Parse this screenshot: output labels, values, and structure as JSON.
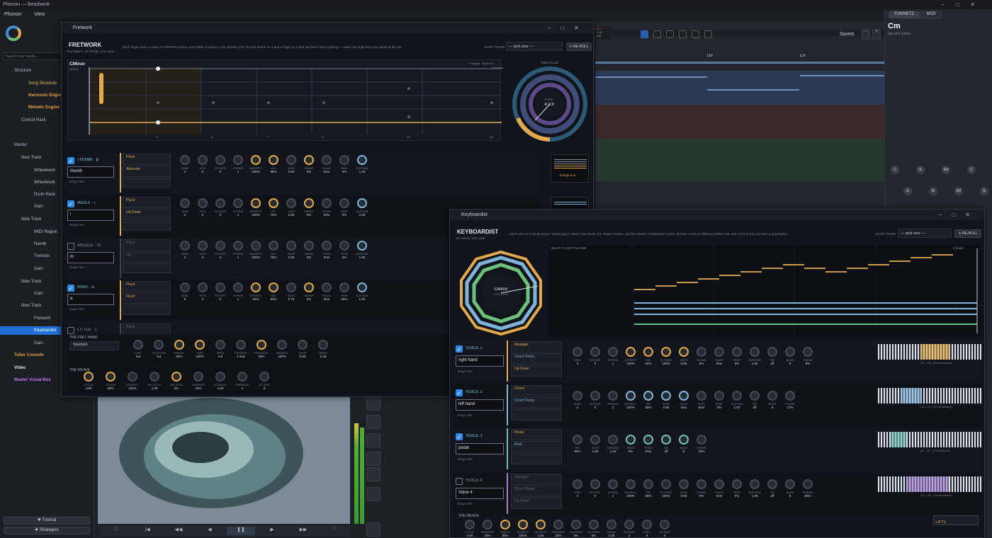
{
  "app": {
    "title": "Phonon — Beadwork",
    "menu": [
      "Phonon",
      "View"
    ],
    "saved": "Saved.",
    "search_placeholder": "Search your tracks..."
  },
  "tree": [
    {
      "label": "Structure",
      "cls": "",
      "indent": 20
    },
    {
      "label": "Song Structure",
      "cls": "yel",
      "indent": 40
    },
    {
      "label": "Harmonic Engine",
      "cls": "orange",
      "indent": 40
    },
    {
      "label": "Melodic Engine",
      "cls": "orange",
      "indent": 40
    },
    {
      "label": "Control Rack",
      "cls": "",
      "indent": 30
    },
    {
      "label": "Master",
      "cls": "",
      "indent": 20
    },
    {
      "label": "New Track",
      "cls": "",
      "indent": 30
    },
    {
      "label": "Wheelwork",
      "cls": "",
      "indent": 48
    },
    {
      "label": "Wheelwork",
      "cls": "",
      "indent": 48
    },
    {
      "label": "Drum Rack",
      "cls": "",
      "indent": 48
    },
    {
      "label": "Gain",
      "cls": "",
      "indent": 48
    },
    {
      "label": "New Track",
      "cls": "",
      "indent": 30
    },
    {
      "label": "MIDI Region",
      "cls": "",
      "indent": 48
    },
    {
      "label": "Namib",
      "cls": "",
      "indent": 48
    },
    {
      "label": "Tremolo",
      "cls": "",
      "indent": 48
    },
    {
      "label": "Gain",
      "cls": "",
      "indent": 48
    },
    {
      "label": "New Track",
      "cls": "",
      "indent": 30
    },
    {
      "label": "Gain",
      "cls": "",
      "indent": 48
    },
    {
      "label": "New Track",
      "cls": "",
      "indent": 30
    },
    {
      "label": "Fretwork",
      "cls": "",
      "indent": 48
    },
    {
      "label": "Keyboardist",
      "cls": "sel",
      "indent": 48
    },
    {
      "label": "Gain",
      "cls": "",
      "indent": 48
    },
    {
      "label": "Tuber Console",
      "cls": "orange",
      "indent": 20
    },
    {
      "label": "Video",
      "cls": "bold",
      "indent": 20
    },
    {
      "label": "Master Visual Bus",
      "cls": "purple",
      "indent": 20
    }
  ],
  "left_buttons": {
    "tutorial": "✚ Tutorial",
    "strategies": "✚ Strategies"
  },
  "timeline": {
    "markers": [
      "G#",
      "C#"
    ],
    "meter": [
      "5L.8",
      "-0.8F",
      "0dB"
    ]
  },
  "right_panel": {
    "tab_tonnetz": "TONNETZ",
    "tab_midi": "MIDI",
    "chord": "Cm",
    "key": "key of C minor",
    "nodes_row1": [
      "C",
      "E",
      "G#",
      "C"
    ],
    "nodes_row2": [
      "G",
      "B",
      "D#",
      "G"
    ]
  },
  "fretwork": {
    "win_title": "Fretwork",
    "heading": "FRETWORK",
    "subtitle": "five fingers, six strings, one cycle",
    "desc": "Each finger owns a range of STRINGS and its own GRID of pulses in the shared cycle. Put the thumb on 4 and a finger on 3 and you have Travis picking — watch the rings they only agree at the top.",
    "start_from": "START FROM",
    "pick": "— pick one —",
    "reroll": "↻ RE-ROLL",
    "chord": "CMinor",
    "chord_sub": "x31013",
    "strings_info": "5 fingers · 6/4/6 of 1",
    "tuning": "Standard",
    "cycle_label": "THE CYCLE",
    "cycle_center": "4:3:8",
    "cycle_sub": "EVERY",
    "fret_nums": [
      "3",
      "5",
      "7",
      "9",
      "12",
      "15"
    ],
    "strip_label": "strings 5–6",
    "fingers": [
      {
        "name": "THUMB",
        "key": "p",
        "on": true,
        "field": "thumb",
        "pattern": "Pluck",
        "rule": "Alternate",
        "knobs": [
          "4",
          "0",
          "0",
          "1",
          "100%",
          "95%",
          "0.80",
          "0%",
          "0ms",
          "0%",
          "1.20"
        ]
      },
      {
        "name": "INDEX",
        "key": "i",
        "on": true,
        "field": "i",
        "pattern": "Pluck",
        "rule": "Up-Down",
        "knobs": [
          "3",
          "0",
          "0",
          "1",
          "100%",
          "70%",
          "0.80",
          "0%",
          "0ms",
          "0%",
          "1.00"
        ]
      },
      {
        "name": "MIDDLE",
        "key": "m",
        "on": false,
        "field": "m",
        "pattern": "Pluck",
        "rule": "Up",
        "knobs": [
          "4",
          "0",
          "0",
          "1",
          "100%",
          "75%",
          "0.95",
          "0%",
          "0ms",
          "0%",
          "1.00"
        ]
      },
      {
        "name": "RING",
        "key": "a",
        "on": true,
        "field": "a",
        "pattern": "Pluck",
        "rule": "Fixed",
        "knobs": [
          "8",
          "0",
          "0",
          "1",
          "45%",
          "62%",
          "0.75",
          "0%",
          "0ms",
          "25%",
          "1.00"
        ]
      },
      {
        "name": "LITTLE",
        "key": "c",
        "on": false,
        "field": "",
        "pattern": "Pluck",
        "rule": "",
        "knobs": []
      }
    ],
    "knob_labels": [
      "GRID",
      "HITS",
      "ROTATE",
      "STRIDE",
      "DENSITY",
      "VEL",
      "GATE",
      "SWING",
      "PUSH",
      "RISE",
      "SUSTAIN"
    ],
    "fret_hand": {
      "label": "THE FRET HAND",
      "tuning": "Standard",
      "knobs": [
        [
          "LAST",
          "nut"
        ],
        [
          "POSITION",
          "nut"
        ],
        [
          "REACH",
          "50%"
        ],
        [
          "TAPS",
          "100%"
        ],
        [
          "SPAN",
          "4.9"
        ],
        [
          "FINGERS",
          "4 max"
        ],
        [
          "GRAVIARY",
          "30%"
        ],
        [
          "VIBRATO",
          "100%"
        ],
        [
          "SLIDE",
          "0.60"
        ],
        [
          "BEND",
          "0.40"
        ]
      ]
    },
    "weave": {
      "label": "THE WEAVE",
      "knobs": [
        [
          "CYCLE",
          "4.00"
        ],
        [
          "TOUCH",
          "50%"
        ],
        [
          "DENSITY",
          "100%"
        ],
        [
          "VELOCITY",
          "1.00"
        ],
        [
          "RELATED",
          "0%"
        ],
        [
          "WANDER",
          "15%"
        ],
        [
          "STRINGS",
          "1.00"
        ],
        [
          "PHRASES",
          "4"
        ],
        [
          "OCTAVE",
          "0"
        ]
      ]
    }
  },
  "keyboardist": {
    "win_title": "Keyboardist",
    "heading": "KEYBOARDIST",
    "subtitle": "ten voices, one cycle",
    "desc": "Each voice is a whole player: what it plays, what it may touch, the shape it tracks, and the stretch of keyboard it owns. Set two voices to different GRIDs over one CYCLE and you have a polyrhythm.",
    "start_from": "START FROM",
    "pick": "— pick one —",
    "reroll": "↻ RE-ROLL",
    "chord": "CMinor",
    "chord_sub": "CYCLE 2.00",
    "played_label": "WHAT IT JUST PLAYED",
    "beats": "4 beats",
    "voices": [
      {
        "name": "VOICE 1",
        "on": true,
        "field": "right hand",
        "color": "#e3a94a",
        "figure": "Arpeggio",
        "palette": "Chord Tones",
        "contour": "Up-Down",
        "range": "C4 – C6 · (24 semitones)",
        "knobs": [
          [
            "GRID",
            "3"
          ],
          [
            "ROTATE",
            "0"
          ],
          [
            "STRIDE",
            "1"
          ],
          [
            "DENSITY",
            "100%"
          ],
          [
            "VEL",
            "62%"
          ],
          [
            "PLONKE",
            "100%"
          ],
          [
            "GATE",
            "0.95"
          ],
          [
            "SWING",
            "0%"
          ],
          [
            "PUSH",
            "0ms"
          ],
          [
            "RISE",
            "0%"
          ],
          [
            "SUSTAIN",
            "1.00"
          ],
          [
            "TIE",
            "off"
          ],
          [
            "BASS",
            "8"
          ],
          [
            "PHASE",
            "0%"
          ]
        ]
      },
      {
        "name": "VOICE 2",
        "on": true,
        "field": "left hand",
        "color": "#7fb3d9",
        "figure": "Chord",
        "palette": "Chord Tones",
        "contour": "",
        "range": "C3 – C4 · (17 semitones)",
        "knobs": [
          [
            "SPAN",
            "2"
          ],
          [
            "ROTATE",
            "0"
          ],
          [
            "SPREAD",
            "2"
          ],
          [
            "DENSITY",
            "100%"
          ],
          [
            "VEL",
            "55%"
          ],
          [
            "GATE",
            "0.95"
          ],
          [
            "PUSH",
            "0ms"
          ],
          [
            "ROLL",
            "8ms"
          ],
          [
            "RISE",
            "0%"
          ],
          [
            "SUSTAIN",
            "1.00"
          ],
          [
            "TIE",
            "off"
          ],
          [
            "BASS",
            "8"
          ],
          [
            "PHASE",
            "17%"
          ]
        ]
      },
      {
        "name": "VOICE 3",
        "on": true,
        "field": "pedal",
        "color": "#6fc2b5",
        "figure": "Pedal",
        "palette": "Root",
        "contour": "",
        "range": "A1 – E2 · (7 semitones)",
        "knobs": [
          [
            "VEL",
            "50%"
          ],
          [
            "GATE",
            "1.00"
          ],
          [
            "SUSTAIN",
            "1.10"
          ],
          [
            "SEED",
            "0%"
          ],
          [
            "PUSH",
            "0ms"
          ],
          [
            "TIE",
            "off"
          ],
          [
            "BASS",
            "8"
          ],
          [
            "PHASE",
            "33%"
          ]
        ]
      },
      {
        "name": "VOICE 4",
        "on": false,
        "field": "Voice 4",
        "color": "#a57fd0",
        "figure": "Arpeggio",
        "palette": "Chord Tones",
        "contour": "Up-Down",
        "range": "C3 – C6 · (36 semitones)",
        "knobs": [
          [
            "GRID",
            "4"
          ],
          [
            "ROTATE",
            "0"
          ],
          [
            "STRIDE",
            "1"
          ],
          [
            "DENSITY",
            "100%"
          ],
          [
            "VEL",
            "65%"
          ],
          [
            "PLONKE",
            "100%"
          ],
          [
            "GATE",
            "0.90"
          ],
          [
            "SWING",
            "0%"
          ],
          [
            "PUSH",
            "0ms"
          ],
          [
            "RISE",
            "0%"
          ],
          [
            "SUSTAIN",
            "1.00"
          ],
          [
            "TIE",
            "off"
          ],
          [
            "BASS",
            "8"
          ],
          [
            "PHASE",
            "50%"
          ]
        ]
      }
    ],
    "weave": {
      "label": "THE WEAVE",
      "knobs": [
        [
          "CYCLE",
          "2.00"
        ],
        [
          "WANDER",
          "10%"
        ],
        [
          "TOUCH",
          "50%"
        ],
        [
          "DENSITY",
          "100%"
        ],
        [
          "VELOCITY",
          "1.00"
        ],
        [
          "PHRASES",
          "25%"
        ],
        [
          "WANDER",
          "8%"
        ],
        [
          "PLONKE",
          "0%"
        ],
        [
          "PEDAL",
          "1.00"
        ],
        [
          "PHRASE",
          "4"
        ],
        [
          "DRIFT",
          "8"
        ],
        [
          "OCTAVE",
          "0"
        ]
      ]
    },
    "lifts": "LIFTS"
  }
}
